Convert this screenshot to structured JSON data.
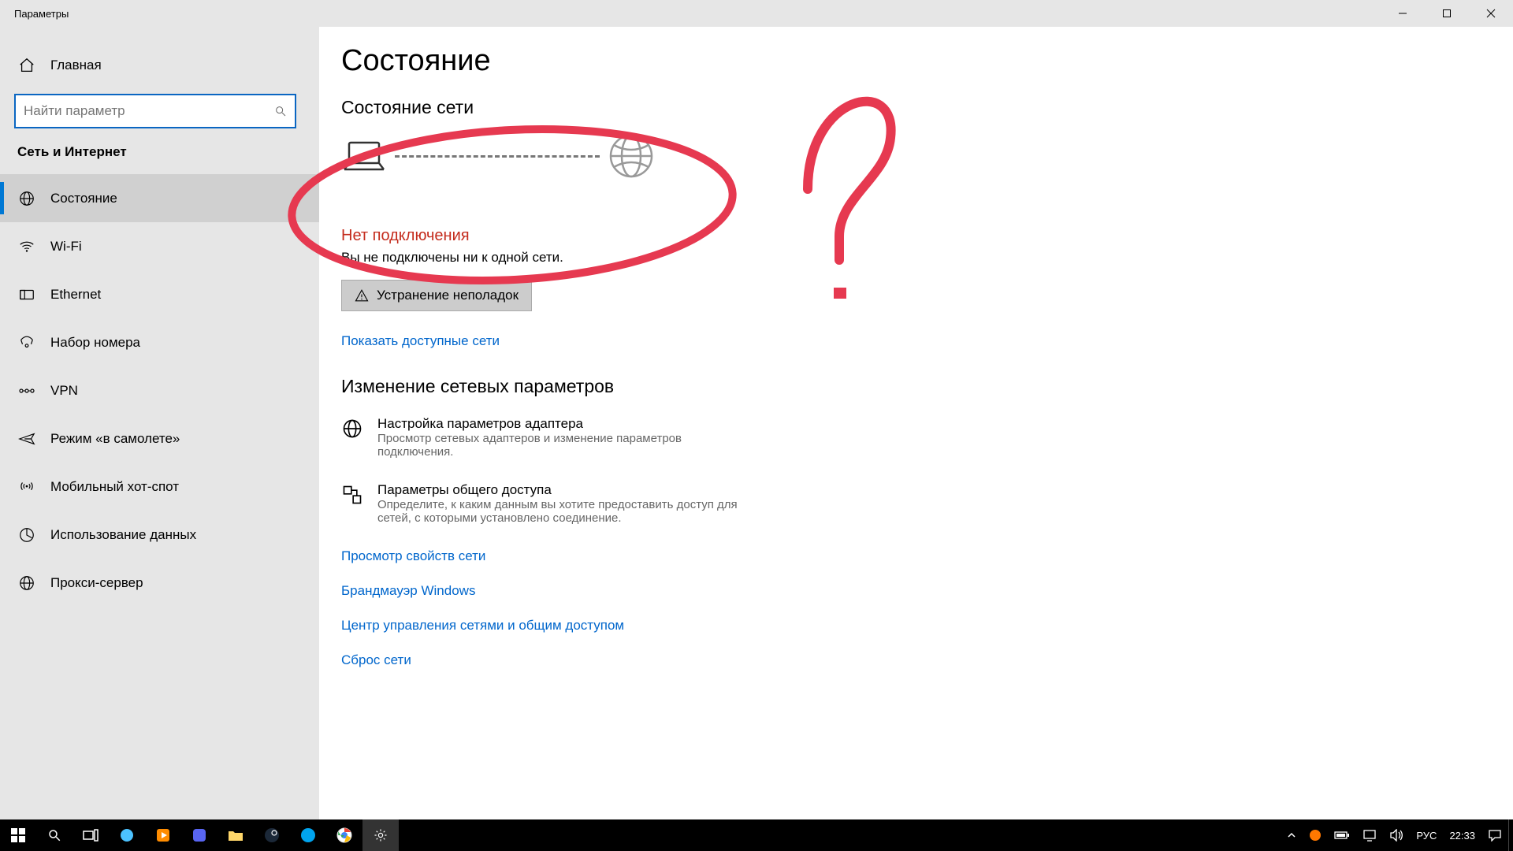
{
  "titlebar": {
    "title": "Параметры"
  },
  "sidebar": {
    "home": "Главная",
    "search_placeholder": "Найти параметр",
    "category": "Сеть и Интернет",
    "items": [
      {
        "label": "Состояние"
      },
      {
        "label": "Wi-Fi"
      },
      {
        "label": "Ethernet"
      },
      {
        "label": "Набор номера"
      },
      {
        "label": "VPN"
      },
      {
        "label": "Режим «в самолете»"
      },
      {
        "label": "Мобильный хот-спот"
      },
      {
        "label": "Использование данных"
      },
      {
        "label": "Прокси-сервер"
      }
    ]
  },
  "main": {
    "title": "Состояние",
    "subtitle": "Состояние сети",
    "no_connection": "Нет подключения",
    "no_conn_desc": "Вы не подключены ни к одной сети.",
    "troubleshoot": "Устранение неполадок",
    "show_networks": "Показать доступные сети",
    "change_title": "Изменение сетевых параметров",
    "opts": [
      {
        "title": "Настройка параметров адаптера",
        "desc": "Просмотр сетевых адаптеров и изменение параметров подключения."
      },
      {
        "title": "Параметры общего доступа",
        "desc": "Определите, к каким данным вы хотите предоставить доступ для сетей, с которыми установлено соединение."
      }
    ],
    "links": [
      "Просмотр свойств сети",
      "Брандмауэр Windows",
      "Центр управления сетями и общим доступом",
      "Сброс сети"
    ]
  },
  "tray": {
    "lang": "РУС",
    "time": "22:33"
  }
}
